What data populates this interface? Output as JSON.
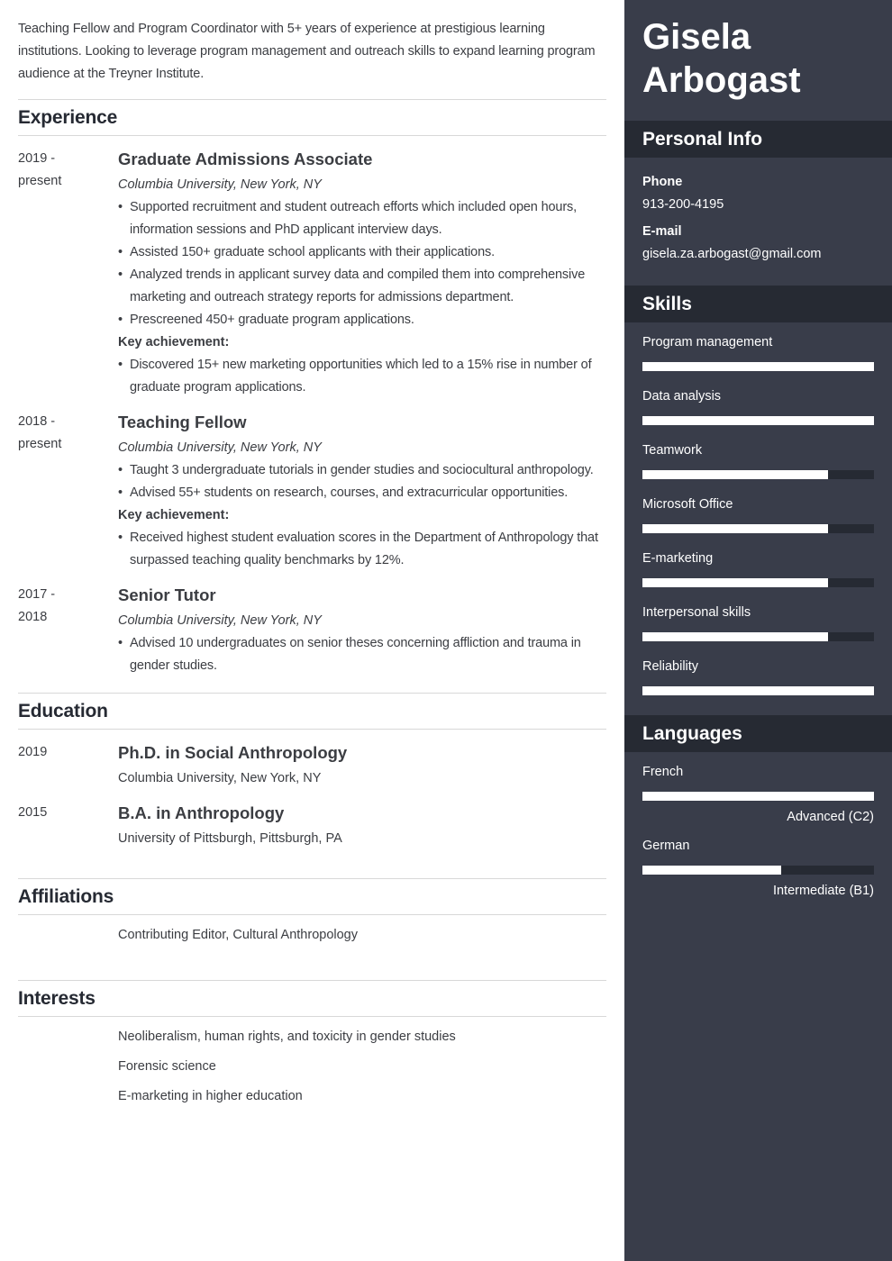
{
  "summary": "Teaching Fellow and Program Coordinator with 5+ years of experience at prestigious learning institutions. Looking to leverage program management and outreach skills to expand learning program audience at the Treyner Institute.",
  "sections": {
    "experience": "Experience",
    "education": "Education",
    "affiliations": "Affiliations",
    "interests": "Interests"
  },
  "experience": [
    {
      "date_start": "2019 -",
      "date_end": "present",
      "title": "Graduate Admissions Associate",
      "company": "Columbia University, New York, NY",
      "bullets": [
        "Supported recruitment and student outreach efforts which included open hours, information sessions and PhD applicant interview days.",
        "Assisted 150+ graduate school applicants with their applications.",
        "Analyzed trends in applicant survey data and compiled them into comprehensive marketing and outreach strategy reports for admissions department.",
        "Prescreened 450+ graduate program applications."
      ],
      "key_label": "Key achievement:",
      "key_bullets": [
        "Discovered 15+ new marketing opportunities which led to a 15% rise in number of graduate program applications."
      ]
    },
    {
      "date_start": "2018 -",
      "date_end": "present",
      "title": "Teaching Fellow",
      "company": "Columbia University, New York, NY",
      "bullets": [
        "Taught 3 undergraduate tutorials in gender studies and sociocultural anthropology.",
        "Advised 55+ students on research, courses, and extracurricular opportunities."
      ],
      "key_label": "Key achievement:",
      "key_bullets": [
        "Received highest student evaluation scores in the Department of Anthropology that surpassed teaching quality benchmarks by 12%."
      ]
    },
    {
      "date_start": "2017 -",
      "date_end": "2018",
      "title": "Senior Tutor",
      "company": "Columbia University, New York, NY",
      "bullets": [
        "Advised 10 undergraduates on senior theses concerning affliction and trauma in gender studies."
      ]
    }
  ],
  "education": [
    {
      "year": "2019",
      "degree": "Ph.D. in Social Anthropology",
      "school": "Columbia University, New York, NY"
    },
    {
      "year": "2015",
      "degree": "B.A. in Anthropology",
      "school": "University of Pittsburgh, Pittsburgh, PA"
    }
  ],
  "affiliations": [
    "Contributing Editor, Cultural Anthropology"
  ],
  "interests": [
    "Neoliberalism, human rights, and toxicity in gender studies",
    "Forensic science",
    "E-marketing in higher education"
  ],
  "sidebar": {
    "name_first": "Gisela",
    "name_last": "Arbogast",
    "personal_info_title": "Personal Info",
    "phone_label": "Phone",
    "phone": "913-200-4195",
    "email_label": "E-mail",
    "email": "gisela.za.arbogast@gmail.com",
    "skills_title": "Skills",
    "skills": [
      {
        "name": "Program management",
        "level": 1.0
      },
      {
        "name": "Data analysis",
        "level": 1.0
      },
      {
        "name": "Teamwork",
        "level": 0.8
      },
      {
        "name": "Microsoft Office",
        "level": 0.8
      },
      {
        "name": "E-marketing",
        "level": 0.8
      },
      {
        "name": "Interpersonal skills",
        "level": 0.8
      },
      {
        "name": "Reliability",
        "level": 1.0
      }
    ],
    "languages_title": "Languages",
    "languages": [
      {
        "name": "French",
        "level": 1.0,
        "level_label": "Advanced (C2)"
      },
      {
        "name": "German",
        "level": 0.6,
        "level_label": "Intermediate (B1)"
      }
    ]
  },
  "colors": {
    "sidebar_bg": "#393d4a",
    "sidebar_header_bg": "#262a33",
    "text": "#3b3d42",
    "heading": "#262a33",
    "bar_fill": "#ffffff",
    "bar_track": "#262a33"
  }
}
